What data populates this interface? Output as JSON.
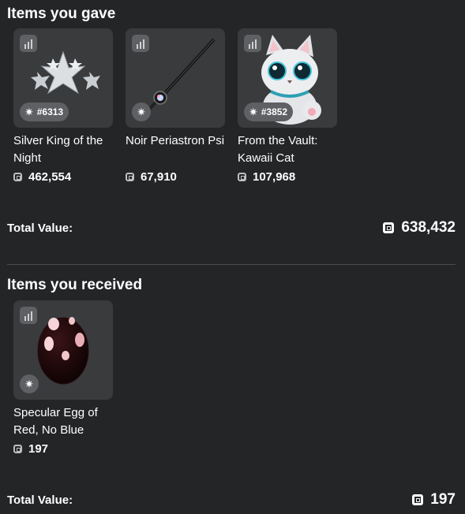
{
  "gave": {
    "title": "Items you gave",
    "items": [
      {
        "name": "Silver King of the Night",
        "serial": "#6313",
        "price": "462,554"
      },
      {
        "name": "Noir Periastron Psi",
        "serial": "",
        "price": "67,910"
      },
      {
        "name": "From the Vault: Kawaii Cat",
        "serial": "#3852",
        "price": "107,968"
      }
    ],
    "total_label": "Total Value:",
    "total_value": "638,432"
  },
  "received": {
    "title": "Items you received",
    "items": [
      {
        "name": "Specular Egg of Red, No Blue",
        "serial": "",
        "price": "197"
      }
    ],
    "total_label": "Total Value:",
    "total_value": "197"
  },
  "icons": {
    "stats": "bar-chart-icon",
    "limited": "sparkle-icon",
    "currency": "robux-icon"
  },
  "colors": {
    "background": "#232527",
    "card": "#393b3d",
    "badge": "#5e6063",
    "text": "#ffffff"
  }
}
